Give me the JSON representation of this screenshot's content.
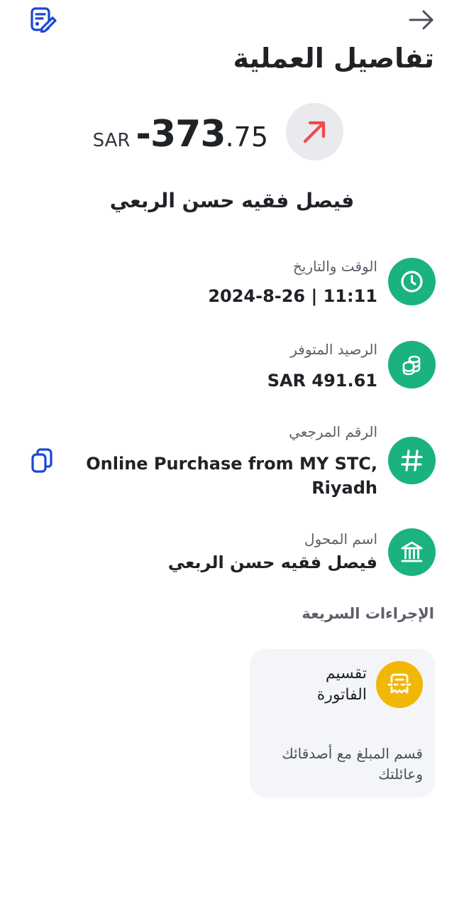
{
  "header": {
    "title": "تفاصيل العملية",
    "edit_icon": "edit-note-icon",
    "back_icon": "arrow-right-icon"
  },
  "transaction": {
    "currency": "SAR",
    "amount_integer": "-373",
    "amount_fraction": ".75",
    "direction_icon": "arrow-up-right-icon",
    "direction_color": "#f04a4a",
    "counterparty": "فيصل فقيه حسن الربعي"
  },
  "details": [
    {
      "label": "الوقت والتاريخ",
      "value": "2024-8-26 | 11:11",
      "icon": "clock-icon"
    },
    {
      "label": "الرصيد المتوفر",
      "value": "SAR 491.61",
      "icon": "coins-icon"
    },
    {
      "label": "الرقم المرجعي",
      "value_line1": "Online Purchase from MY STC,",
      "value_line2": "Riyadh",
      "icon": "hash-icon",
      "copy_icon": "copy-icon"
    },
    {
      "label": "اسم المحول",
      "value": "فيصل فقيه حسن الربعي",
      "icon": "bank-icon"
    }
  ],
  "quick_actions": {
    "heading": "الإجراءات السريعة",
    "items": [
      {
        "title": "تقسيم الفاتورة",
        "description": "قسم المبلغ مع أصدقائك وعائلتك",
        "icon": "split-bill-icon"
      }
    ]
  },
  "colors": {
    "accent_green": "#1ab37d",
    "accent_yellow": "#f2b705",
    "link_blue": "#1a47d6",
    "card_bg": "#f4f5f9"
  }
}
